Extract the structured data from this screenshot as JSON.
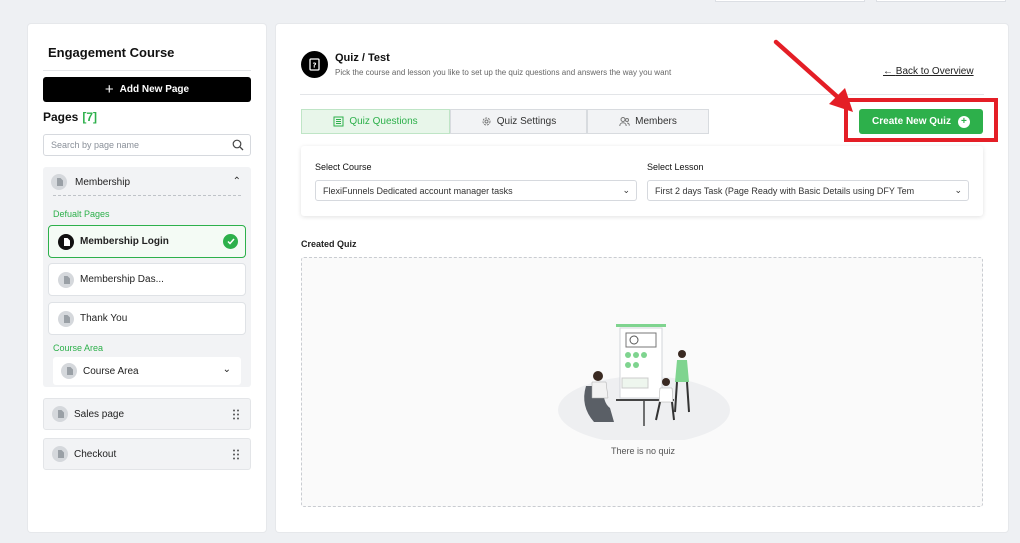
{
  "sidebar": {
    "title": "Engagement Course",
    "add_page_label": "Add New Page",
    "pages_label": "Pages",
    "pages_count": "[7]",
    "search_placeholder": "Search by page name",
    "group": {
      "name": "Membership",
      "default_pages_label": "Defualt Pages",
      "pages": [
        "Membership Login",
        "Membership Das...",
        "Thank You"
      ],
      "course_area_label": "Course Area",
      "course_area_dropdown": "Course Area"
    },
    "other_pages": [
      "Sales page",
      "Checkout"
    ]
  },
  "header": {
    "title": "Quiz / Test",
    "subtitle": "Pick the course and lesson you like to set up the quiz questions and answers the way you want",
    "back_link": "Back to Overview"
  },
  "tabs": [
    "Quiz Questions",
    "Quiz Settings",
    "Members"
  ],
  "create_button": "Create New Quiz",
  "selectors": {
    "course_label": "Select Course",
    "course_value": "FlexiFunnels Dedicated account manager tasks",
    "lesson_label": "Select Lesson",
    "lesson_value": "First 2 days Task (Page Ready with Basic Details using DFY Tem"
  },
  "created_quiz_label": "Created Quiz",
  "empty_message": "There is no quiz",
  "colors": {
    "accent_green": "#2db04b",
    "highlight_red": "#e41e26"
  }
}
